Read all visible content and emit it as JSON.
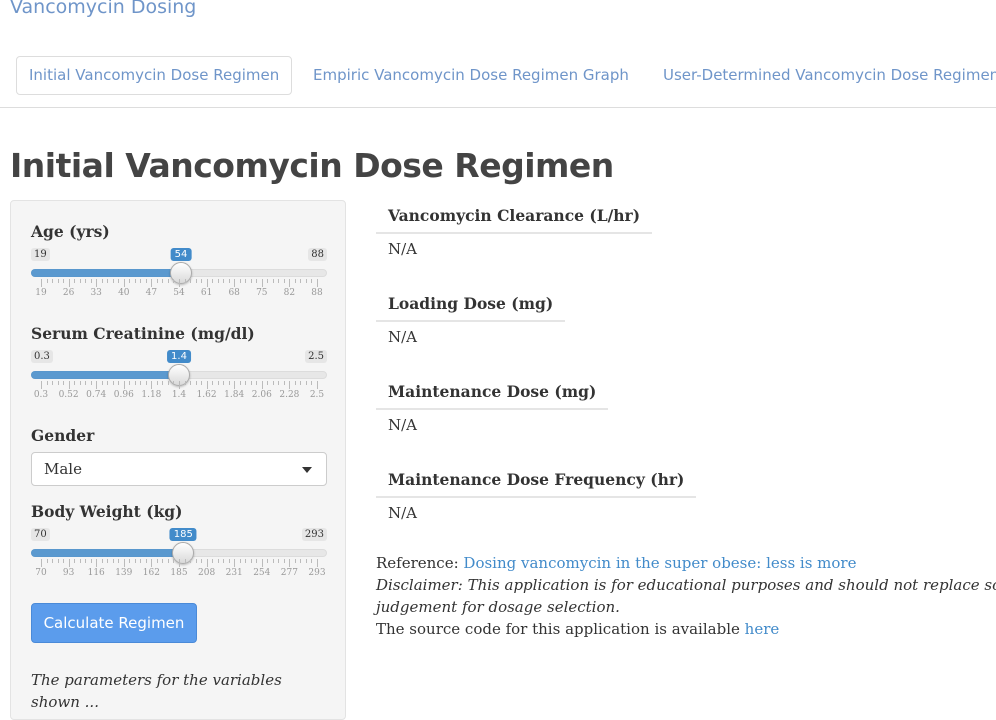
{
  "app": {
    "title": "Vancomycin Dosing"
  },
  "tabs": [
    {
      "label": "Initial Vancomycin Dose Regimen",
      "active": true
    },
    {
      "label": "Empiric Vancomycin Dose Regimen Graph",
      "active": false
    },
    {
      "label": "User-Determined Vancomycin Dose Regimen",
      "active": false
    }
  ],
  "page": {
    "title": "Initial Vancomycin Dose Regimen"
  },
  "inputs": {
    "age": {
      "label": "Age (yrs)",
      "min": "19",
      "max": "88",
      "value": "54",
      "min_num": 19,
      "max_num": 88,
      "value_num": 54,
      "ticks": [
        "19",
        "26",
        "33",
        "40",
        "47",
        "54",
        "61",
        "68",
        "75",
        "82",
        "88"
      ]
    },
    "creatinine": {
      "label": "Serum Creatinine (mg/dl)",
      "min": "0.3",
      "max": "2.5",
      "value": "1.4",
      "min_num": 0.3,
      "max_num": 2.5,
      "value_num": 1.4,
      "ticks": [
        "0.3",
        "0.52",
        "0.74",
        "0.96",
        "1.18",
        "1.4",
        "1.62",
        "1.84",
        "2.06",
        "2.28",
        "2.5"
      ]
    },
    "gender": {
      "label": "Gender",
      "value": "Male"
    },
    "weight": {
      "label": "Body Weight (kg)",
      "min": "70",
      "max": "293",
      "value": "185",
      "min_num": 70,
      "max_num": 293,
      "value_num": 185,
      "ticks": [
        "70",
        "93",
        "116",
        "139",
        "162",
        "185",
        "208",
        "231",
        "254",
        "277",
        "293"
      ]
    },
    "calculate_label": "Calculate Regimen",
    "note": "The parameters for the variables shown ..."
  },
  "outputs": [
    {
      "label": "Vancomycin Clearance (L/hr)",
      "value": "N/A"
    },
    {
      "label": "Loading Dose (mg)",
      "value": "N/A"
    },
    {
      "label": "Maintenance Dose (mg)",
      "value": "N/A"
    },
    {
      "label": "Maintenance Dose Frequency (hr)",
      "value": "N/A"
    }
  ],
  "footer": {
    "reference_label": "Reference:",
    "reference_link": "Dosing vancomycin in the super obese: less is more",
    "disclaimer_label": "Disclaimer:",
    "disclaimer_text_1": "This application is for educational purposes and should not replace sound",
    "disclaimer_text_2": "judgement for dosage selection.",
    "source_text": "The source code for this application is available",
    "source_link": "here"
  },
  "colors": {
    "accent": "#428bca",
    "link": "#6f95c9",
    "button": "#5b9cec"
  }
}
